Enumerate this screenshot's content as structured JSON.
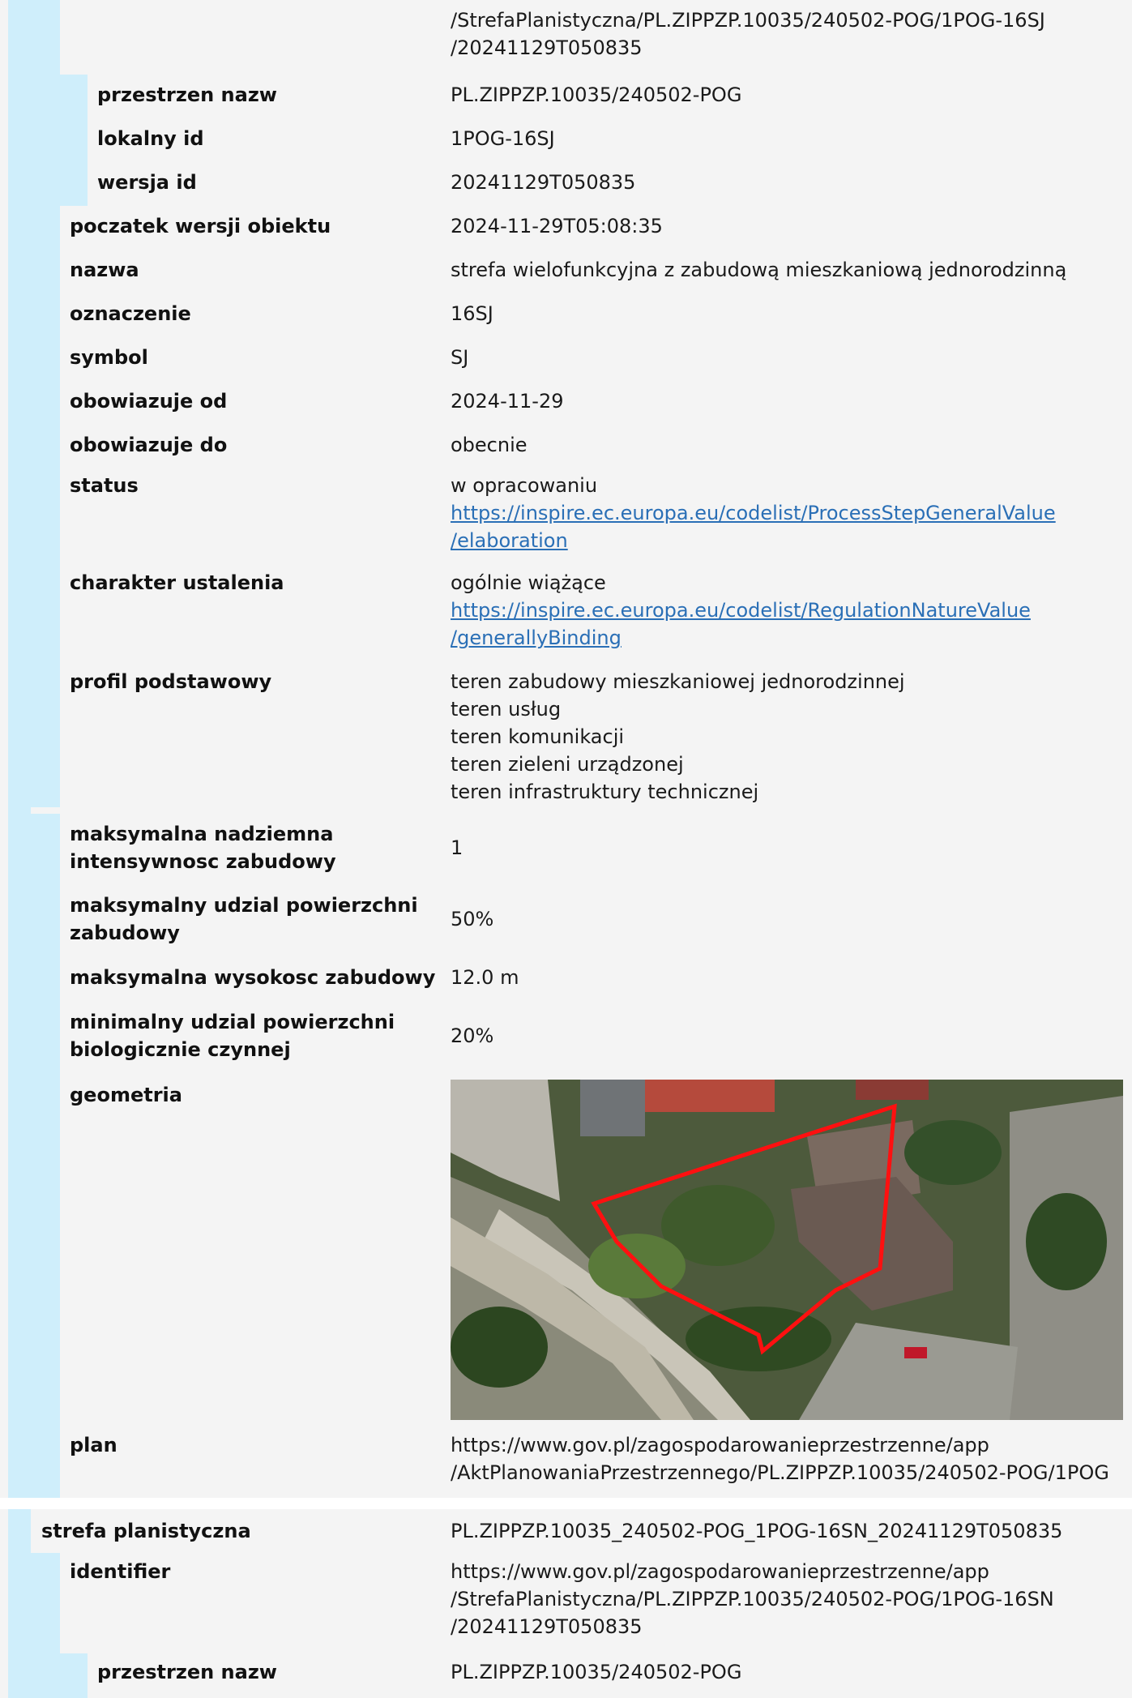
{
  "colors": {
    "bar": "#cfeefb",
    "section_bg": "#f4f4f4",
    "link": "#2a6fb6",
    "outline": "#ff1010"
  },
  "section1": {
    "identifier_tail": [
      "/StrefaPlanistyczna/PL.ZIPPZP.10035/240502-POG/1POG-16SJ",
      "/20241129T050835"
    ],
    "przestrzen_nazw": {
      "label": "przestrzen nazw",
      "value": "PL.ZIPPZP.10035/240502-POG"
    },
    "lokalny_id": {
      "label": "lokalny id",
      "value": "1POG-16SJ"
    },
    "wersja_id": {
      "label": "wersja id",
      "value": "20241129T050835"
    },
    "poczatek_wersji": {
      "label": "poczatek wersji obiektu",
      "value": "2024-11-29T05:08:35"
    },
    "nazwa": {
      "label": "nazwa",
      "value": "strefa wielofunkcyjna z zabudową mieszkaniową jednorodzinną"
    },
    "oznaczenie": {
      "label": "oznaczenie",
      "value": "16SJ"
    },
    "symbol": {
      "label": "symbol",
      "value": "SJ"
    },
    "obowiazuje_od": {
      "label": "obowiazuje od",
      "value": "2024-11-29"
    },
    "obowiazuje_do": {
      "label": "obowiazuje do",
      "value": "obecnie"
    },
    "status": {
      "label": "status",
      "text": "w opracowaniu",
      "link_lines": [
        "https://inspire.ec.europa.eu/codelist/ProcessStepGeneralValue",
        "/elaboration"
      ]
    },
    "charakter": {
      "label": "charakter ustalenia",
      "text": "ogólnie wiążące",
      "link_lines": [
        "https://inspire.ec.europa.eu/codelist/RegulationNatureValue",
        "/generallyBinding"
      ]
    },
    "profil": {
      "label": "profil podstawowy",
      "values": [
        "teren zabudowy mieszkaniowej jednorodzinnej",
        "teren usług",
        "teren komunikacji",
        "teren zieleni urządzonej",
        "teren infrastruktury technicznej"
      ]
    },
    "intensywnosc": {
      "label_lines": [
        "maksymalna nadziemna",
        "intensywnosc zabudowy"
      ],
      "value": "1"
    },
    "udzial_zabudowy": {
      "label_lines": [
        "maksymalny udzial powierzchni",
        "zabudowy"
      ],
      "value": "50%"
    },
    "wysokosc": {
      "label": "maksymalna wysokosc zabudowy",
      "value": "12.0 m"
    },
    "biologicznie": {
      "label_lines": [
        "minimalny udzial powierzchni",
        "biologicznie czynnej"
      ],
      "value": "20%"
    },
    "geometria": {
      "label": "geometria"
    },
    "plan": {
      "label": "plan",
      "lines": [
        "https://www.gov.pl/zagospodarowanieprzestrzenne/app",
        "/AktPlanowaniaPrzestrzennego/PL.ZIPPZP.10035/240502-POG/1POG"
      ]
    }
  },
  "section2": {
    "strefa": {
      "label": "strefa planistyczna",
      "value": "PL.ZIPPZP.10035_240502-POG_1POG-16SN_20241129T050835"
    },
    "identifier": {
      "label": "identifier",
      "lines": [
        "https://www.gov.pl/zagospodarowanieprzestrzenne/app",
        "/StrefaPlanistyczna/PL.ZIPPZP.10035/240502-POG/1POG-16SN",
        "/20241129T050835"
      ]
    },
    "przestrzen_nazw": {
      "label": "przestrzen nazw",
      "value": "PL.ZIPPZP.10035/240502-POG"
    }
  }
}
